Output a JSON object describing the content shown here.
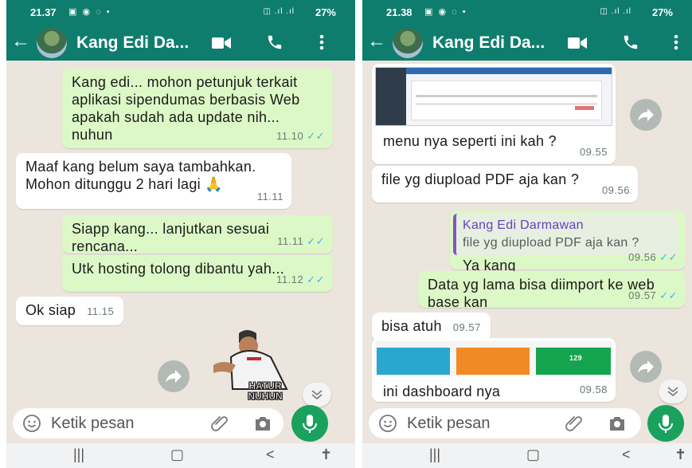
{
  "left": {
    "status": {
      "time": "21.37",
      "battery": "27%"
    },
    "contact_name": "Kang Edi Da...",
    "messages": [
      {
        "text": "Kang edi...  mohon petunjuk terkait aplikasi sipendumas berbasis Web apakah sudah ada  update nih... nuhun",
        "time": "11.10"
      },
      {
        "text": "Maaf kang belum saya tambahkan. Mohon ditunggu 2 hari lagi 🙏",
        "time": "11.11"
      },
      {
        "text": "Siapp kang... lanjutkan sesuai rencana...",
        "time": "11.11"
      },
      {
        "text": "Utk hosting tolong dibantu yah...",
        "time": "11.12"
      },
      {
        "text": "Ok siap",
        "time": "11.15"
      }
    ],
    "sticker_text": "HATUR NUHUN",
    "input_placeholder": "Ketik pesan"
  },
  "right": {
    "status": {
      "time": "21.38",
      "battery": "27%"
    },
    "contact_name": "Kang Edi Da...",
    "messages": [
      {
        "text": "menu nya seperti ini kah ?",
        "time": "09.55"
      },
      {
        "text": "file yg diupload PDF aja kan ?",
        "time": "09.56"
      },
      {
        "quote_name": "Kang Edi Darmawan",
        "quote_text": "file yg diupload PDF aja kan ?",
        "text": "Ya kang",
        "time": "09.56"
      },
      {
        "text": "Data yg lama bisa diimport ke web base kan",
        "time": "09.57"
      },
      {
        "text": "bisa atuh",
        "time": "09.57"
      },
      {
        "text": "ini dashboard nya",
        "time": "09.58"
      }
    ],
    "dashboard_count": "129",
    "input_placeholder": "Ketik pesan"
  },
  "colors": {
    "header": "#0e7d6e",
    "chat_bg": "#ece5dd",
    "outgoing": "#dcf8c6",
    "incoming": "#ffffff",
    "tick_blue": "#34b7f1",
    "mic": "#1aa15e"
  },
  "icons": [
    "back-arrow-icon",
    "video-call-icon",
    "phone-icon",
    "menu-dots-icon",
    "forward-icon",
    "emoji-icon",
    "attach-icon",
    "camera-icon",
    "mic-icon",
    "chevron-down-icon",
    "recents-icon",
    "home-icon",
    "back-icon",
    "accessibility-icon"
  ]
}
